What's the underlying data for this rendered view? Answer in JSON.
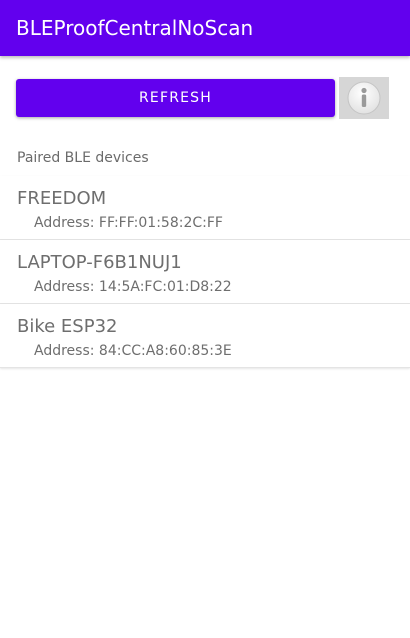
{
  "app": {
    "title": "BLEProofCentralNoScan"
  },
  "toolbar": {
    "refresh_label": "REFRESH",
    "info_icon": "info-icon"
  },
  "section": {
    "label": "Paired BLE devices"
  },
  "devices": [
    {
      "name": "FREEDOM",
      "address": "Address: FF:FF:01:58:2C:FF"
    },
    {
      "name": "LAPTOP-F6B1NUJ1",
      "address": "Address: 14:5A:FC:01:D8:22"
    },
    {
      "name": "Bike ESP32",
      "address": "Address: 84:CC:A8:60:85:3E"
    }
  ],
  "colors": {
    "primary": "#6200ee",
    "text_secondary": "#6e6e6e"
  }
}
